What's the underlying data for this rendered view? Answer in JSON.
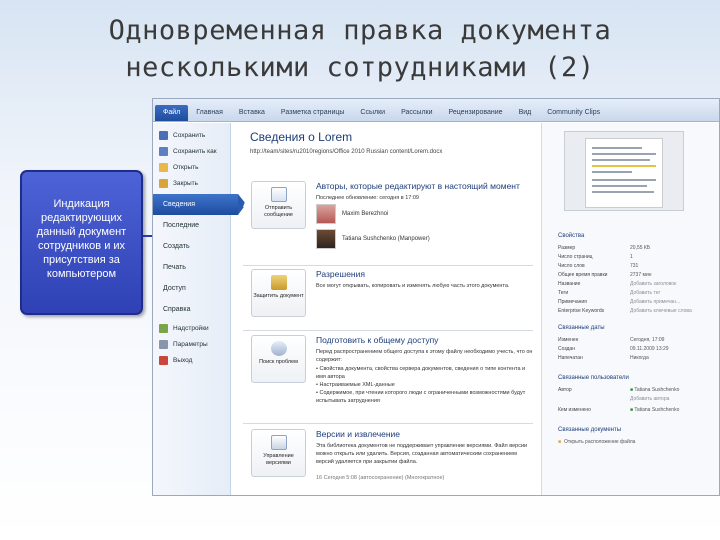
{
  "slide": {
    "title_line1": "Одновременная правка документа",
    "title_line2": "несколькими сотрудниками (2)",
    "callout_lines": [
      "Индикация",
      "редактирующих",
      "данный документ",
      "сотрудников и их",
      "присутствия за",
      "компьютером"
    ]
  },
  "colors": {
    "callout": "#3a4fc8",
    "accent": "#1f4d9e",
    "title_text": "#3a3a3a"
  },
  "app": {
    "ribbon_tabs": [
      "Файл",
      "Главная",
      "Вставка",
      "Разметка страницы",
      "Ссылки",
      "Рассылки",
      "Рецензирование",
      "Вид",
      "Community Clips"
    ],
    "nav": {
      "commands": [
        {
          "label": "Сохранить",
          "icon": "save-icon"
        },
        {
          "label": "Сохранить как",
          "icon": "save-as-icon"
        },
        {
          "label": "Открыть",
          "icon": "open-folder-icon"
        },
        {
          "label": "Закрыть",
          "icon": "close-folder-icon"
        }
      ],
      "sections": [
        "Сведения",
        "Последние",
        "Создать",
        "Печать",
        "Доступ",
        "Справка"
      ],
      "tools": [
        {
          "label": "Надстройки",
          "icon": "addins-icon"
        },
        {
          "label": "Параметры",
          "icon": "options-icon"
        },
        {
          "label": "Выход",
          "icon": "exit-icon"
        }
      ]
    },
    "info": {
      "title": "Сведения о Lorem",
      "path": "http://team/sites/ru2010regions/Office 2010 Russian content/Lorem.docx",
      "authors": {
        "button_label": "Отправить сообщение",
        "heading": "Авторы, которые редактируют в настоящий момент",
        "updated": "Последнее обновление: сегодня в 17:09",
        "people": [
          "Maxim Berezhnoi",
          "Tatiana Sushchenko (Manpower)"
        ]
      },
      "permissions": {
        "button_label": "Защитить документ",
        "heading": "Разрешения",
        "text": "Все могут открывать, копировать и изменять любую часть этого документа."
      },
      "prepare": {
        "button_label": "Поиск проблем",
        "heading": "Подготовить к общему доступу",
        "text": "Перед распространением общего доступа к этому файлу необходимо учесть, что он содержит:",
        "bullets": [
          "Свойства документа, свойства сервера документов, сведения о типе контента и имя автора",
          "Настраиваемые XML-данные",
          "Содержимое, при чтении которого люди с ограниченными возможностями будут испытывать затруднения"
        ]
      },
      "versions": {
        "button_label": "Управление версиями",
        "heading": "Версии и извлечение",
        "text": "Эта библиотека документов не поддерживает управление версиями. Файл версии можно открыть или удалить. Версия, созданная автоматическим сохранением версий удаляется при закрытии файла.",
        "autosave": "16 Сегодня 5:08 (автосохранение) (Многократное)"
      }
    },
    "properties": {
      "header": "Свойства",
      "rows": [
        {
          "k": "Размер",
          "v": "20,55 КБ",
          "dim": false
        },
        {
          "k": "Число страниц",
          "v": "1",
          "dim": false
        },
        {
          "k": "Число слов",
          "v": "731",
          "dim": false
        },
        {
          "k": "Общее время правки",
          "v": "2737 мин",
          "dim": false
        },
        {
          "k": "Название",
          "v": "Добавить заголовок",
          "dim": true
        },
        {
          "k": "Теги",
          "v": "Добавить тег",
          "dim": true
        },
        {
          "k": "Примечания",
          "v": "Добавить примечан...",
          "dim": true
        },
        {
          "k": "Enterprise Keywords",
          "v": "Добавить ключевые слова",
          "dim": true
        }
      ],
      "dates_header": "Связанные даты",
      "dates": [
        {
          "k": "Изменен",
          "v": "Сегодня, 17:09"
        },
        {
          "k": "Создан",
          "v": "09.11.2009 13:29"
        },
        {
          "k": "Напечатан",
          "v": "Никогда"
        }
      ],
      "people_header": "Связанные пользователи",
      "people": [
        {
          "k": "Автор",
          "v": "Tatiana Sushchenko"
        },
        {
          "k": "",
          "v": "Добавить автора"
        },
        {
          "k": "Кем изменено",
          "v": "Tatiana Sushchenko"
        }
      ],
      "docs_header": "Связанные документы",
      "docs_link": "Открыть расположение файла"
    }
  }
}
